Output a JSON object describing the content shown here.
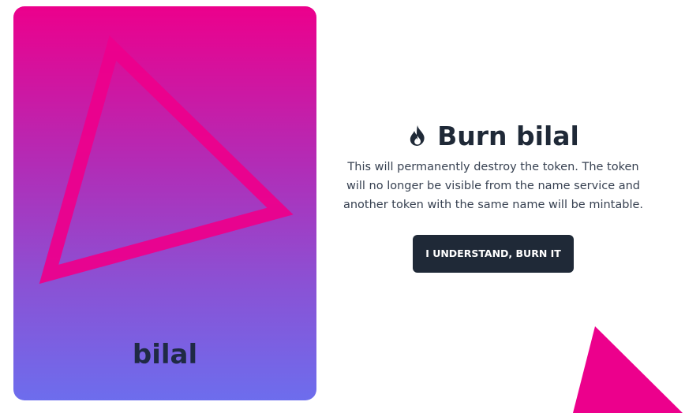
{
  "card": {
    "name": "bilal"
  },
  "panel": {
    "icon": "fire-icon",
    "title": "Burn bilal",
    "description": "This will permanently destroy the token. The token will no longer be visible from the name service and another token with the same name will be mintable.",
    "button_label": "I UNDERSTAND, BURN IT"
  },
  "colors": {
    "accent": "#ec008c",
    "gradient_bottom": "#6d6ded",
    "button_bg": "#1f2937",
    "title_text": "#1f2937"
  }
}
